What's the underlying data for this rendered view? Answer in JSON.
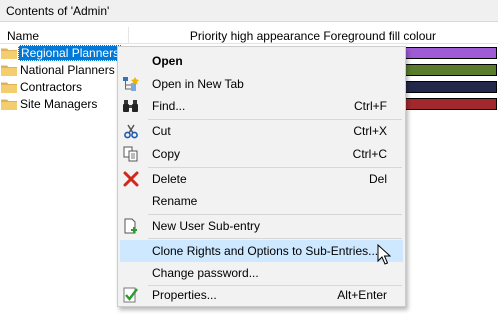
{
  "window": {
    "title": "Contents of 'Admin'"
  },
  "columns": {
    "name": "Name",
    "second": "Priority high appearance Foreground fill colour"
  },
  "rows": [
    {
      "label": "Regional Planners",
      "color": "#9f5ad5"
    },
    {
      "label": "National Planners",
      "color": "#5a7d2b"
    },
    {
      "label": "Contractors",
      "color": "#23284a"
    },
    {
      "label": "Site Managers",
      "color": "#a3282d"
    }
  ],
  "menu": {
    "items": [
      {
        "label": "Open",
        "shortcut": "",
        "icon": "none"
      },
      {
        "label": "Open in New Tab",
        "shortcut": "",
        "icon": "tree-tab-icon"
      },
      {
        "label": "Find...",
        "shortcut": "Ctrl+F",
        "icon": "binoculars-icon"
      },
      {
        "label": "Cut",
        "shortcut": "Ctrl+X",
        "icon": "scissors-icon"
      },
      {
        "label": "Copy",
        "shortcut": "Ctrl+C",
        "icon": "copy-icon"
      },
      {
        "label": "Delete",
        "shortcut": "Del",
        "icon": "red-x-icon"
      },
      {
        "label": "Rename",
        "shortcut": "",
        "icon": "none"
      },
      {
        "label": "New User Sub-entry",
        "shortcut": "",
        "icon": "new-document-icon"
      },
      {
        "label": "Clone Rights and Options to Sub-Entries...",
        "shortcut": "",
        "icon": "none"
      },
      {
        "label": "Change password...",
        "shortcut": "",
        "icon": "none"
      },
      {
        "label": "Properties...",
        "shortcut": "Alt+Enter",
        "icon": "green-check-icon"
      }
    ]
  },
  "colors": {
    "selection": "#0078d7",
    "menu_hover": "#cde8ff",
    "menu_background": "#f2f2f2"
  }
}
